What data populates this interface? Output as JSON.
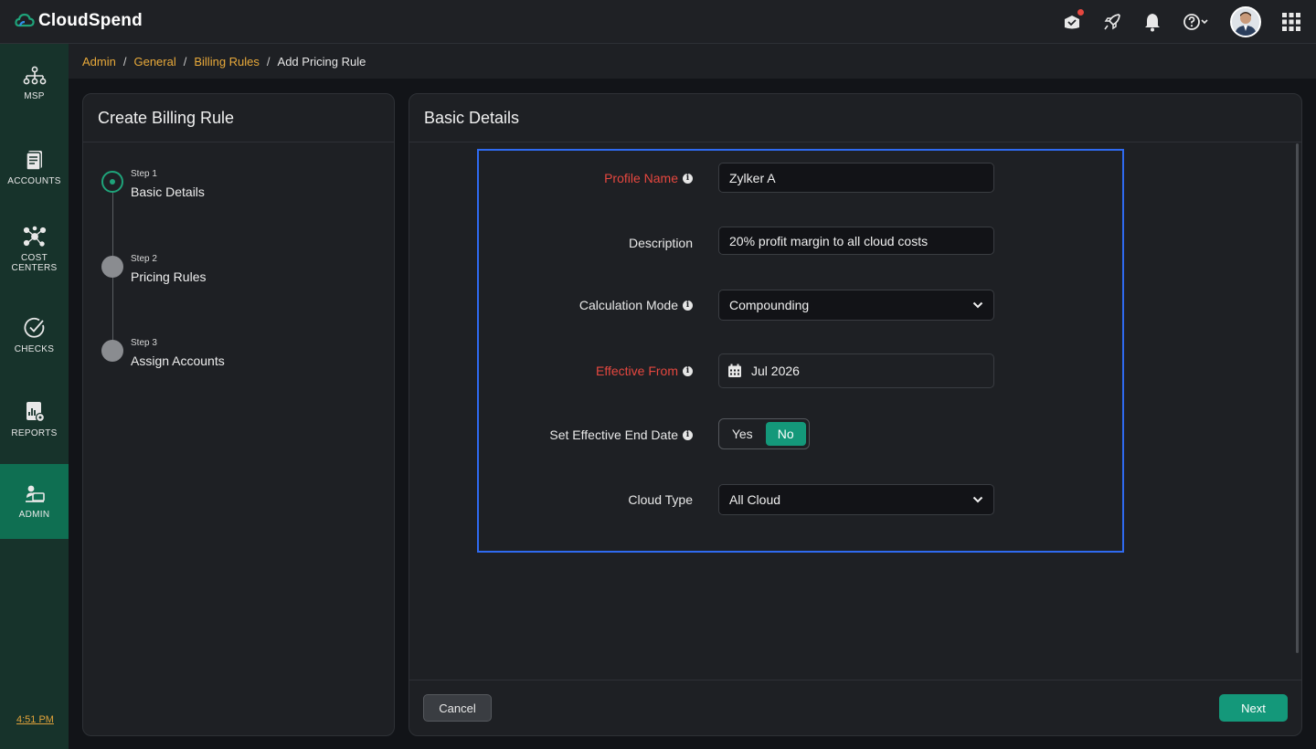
{
  "app": {
    "name": "CloudSpend"
  },
  "topbar": {
    "icons": [
      "whats-new-icon",
      "rocket-icon",
      "bell-icon",
      "help-icon",
      "avatar",
      "apps-grid-icon"
    ]
  },
  "sidenav": {
    "items": [
      {
        "label": "MSP",
        "icon": "org-chart-icon"
      },
      {
        "label": "ACCOUNTS",
        "icon": "accounts-icon"
      },
      {
        "label": "COST CENTERS",
        "icon": "cost-centers-icon"
      },
      {
        "label": "CHECKS",
        "icon": "checks-icon"
      },
      {
        "label": "REPORTS",
        "icon": "reports-icon"
      },
      {
        "label": "ADMIN",
        "icon": "admin-icon",
        "active": true
      }
    ],
    "time": "4:51 PM"
  },
  "breadcrumb": {
    "items": [
      "Admin",
      "General",
      "Billing Rules"
    ],
    "current": "Add Pricing Rule",
    "separator": "/"
  },
  "left_panel": {
    "title": "Create Billing Rule",
    "steps": [
      {
        "num": "Step 1",
        "title": "Basic Details"
      },
      {
        "num": "Step 2",
        "title": "Pricing Rules"
      },
      {
        "num": "Step 3",
        "title": "Assign Accounts"
      }
    ]
  },
  "right_panel": {
    "title": "Basic Details",
    "form": {
      "profile_name": {
        "label": "Profile Name",
        "value": "Zylker A"
      },
      "description": {
        "label": "Description",
        "value": "20% profit margin to all cloud costs"
      },
      "calculation_mode": {
        "label": "Calculation Mode",
        "value": "Compounding"
      },
      "effective_from": {
        "label": "Effective From",
        "value": "Jul 2026"
      },
      "effective_end": {
        "label": "Set Effective End Date",
        "yes": "Yes",
        "no": "No",
        "selected": "No"
      },
      "cloud_type": {
        "label": "Cloud Type",
        "value": "All Cloud"
      }
    },
    "info_glyph": "i"
  },
  "footer": {
    "cancel": "Cancel",
    "next": "Next"
  },
  "colors": {
    "accent": "#14987a",
    "required": "#e5473f",
    "link": "#e8a93a",
    "highlight_border": "#2f6af0",
    "nav_bg": "#17332b",
    "nav_active": "#0f6f52"
  }
}
